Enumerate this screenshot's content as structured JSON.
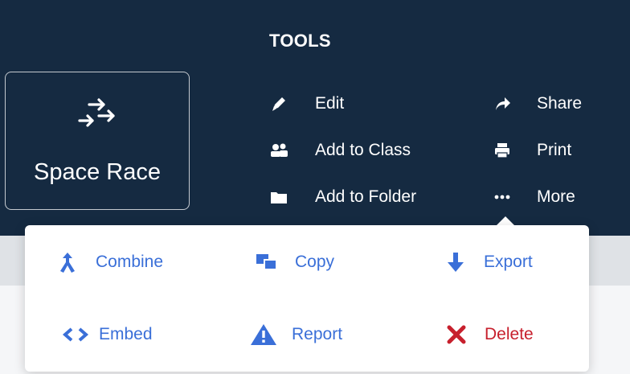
{
  "mode": {
    "label": "Space Race",
    "icon": "arrows-right-icon"
  },
  "tools": {
    "heading": "TOOLS",
    "items": [
      {
        "label": "Edit",
        "icon": "pencil-icon"
      },
      {
        "label": "Add to Class",
        "icon": "people-icon"
      },
      {
        "label": "Add to Folder",
        "icon": "folder-icon"
      },
      {
        "label": "Share",
        "icon": "share-arrow-icon"
      },
      {
        "label": "Print",
        "icon": "printer-icon"
      },
      {
        "label": "More",
        "icon": "ellipsis-icon"
      }
    ]
  },
  "more_menu": {
    "items": [
      {
        "label": "Combine",
        "icon": "merge-icon"
      },
      {
        "label": "Copy",
        "icon": "copy-icon"
      },
      {
        "label": "Export",
        "icon": "arrow-down-icon"
      },
      {
        "label": "Embed",
        "icon": "code-icon"
      },
      {
        "label": "Report",
        "icon": "warning-icon"
      },
      {
        "label": "Delete",
        "icon": "x-icon"
      }
    ]
  },
  "colors": {
    "header_bg": "#152a41",
    "menu_link": "#3a6fd8",
    "danger": "#c7202d"
  }
}
